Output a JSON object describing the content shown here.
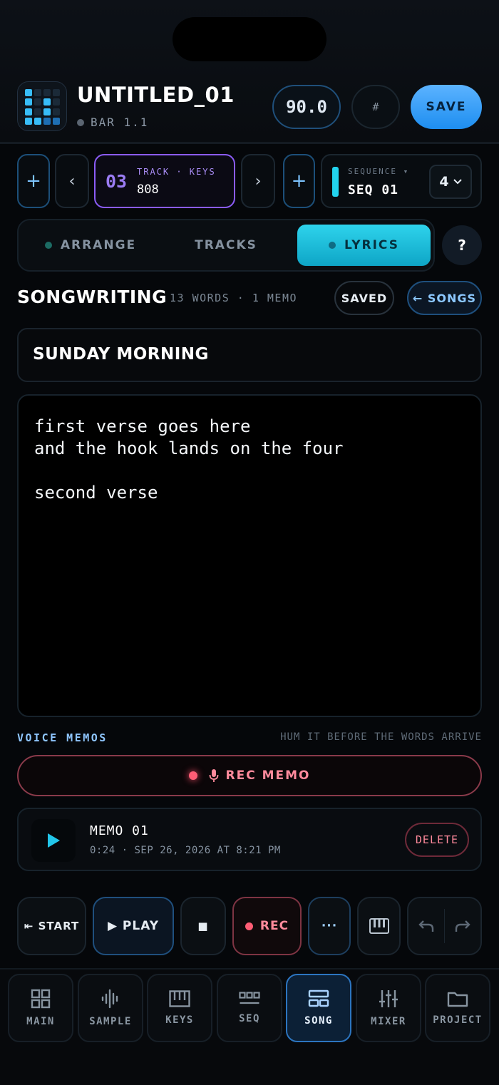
{
  "header": {
    "project_title": "UNTITLED_01",
    "bar_position": "BAR 1.1",
    "bpm": "90.0",
    "hash_label": "#",
    "save_label": "SAVE"
  },
  "track": {
    "add_label": "+",
    "prev_label": "‹",
    "next_label": "›",
    "number": "03",
    "caption": "TRACK · KEYS",
    "name": "808",
    "add_right_label": "+"
  },
  "sequence": {
    "caption": "SEQUENCE ▾",
    "name": "SEQ 01",
    "count": "4"
  },
  "tabs": [
    {
      "label": "ARRANGE",
      "active": false
    },
    {
      "label": "TRACKS",
      "active": false
    },
    {
      "label": "LYRICS",
      "active": true
    }
  ],
  "help_label": "?",
  "songwriting": {
    "title": "SONGWRITING",
    "meta": "13 WORDS · 1 MEMO",
    "saved_label": "SAVED",
    "songs_label": "← SONGS",
    "song_title": "SUNDAY MORNING",
    "lyrics": "first verse goes here\nand the hook lands on the four\n\nsecond verse"
  },
  "voice_memos": {
    "label": "VOICE MEMOS",
    "hint": "HUM IT BEFORE THE WORDS ARRIVE",
    "rec_label": "REC MEMO",
    "memos": [
      {
        "name": "MEMO 01",
        "meta": "0:24 · SEP 26, 2026 AT 8:21 PM",
        "delete_label": "DELETE"
      }
    ]
  },
  "transport": {
    "start_label": "⇤ START",
    "play_label": "▶ PLAY",
    "stop_label": "■",
    "rec_label": "REC",
    "more_label": "···"
  },
  "nav": [
    {
      "label": "MAIN",
      "icon": "grid-icon",
      "active": false
    },
    {
      "label": "SAMPLE",
      "icon": "waveform-icon",
      "active": false
    },
    {
      "label": "KEYS",
      "icon": "piano-icon",
      "active": false
    },
    {
      "label": "SEQ",
      "icon": "sequencer-icon",
      "active": false
    },
    {
      "label": "SONG",
      "icon": "song-icon",
      "active": true
    },
    {
      "label": "MIXER",
      "icon": "sliders-icon",
      "active": false
    },
    {
      "label": "PROJECT",
      "icon": "folder-icon",
      "active": false
    }
  ],
  "colors": {
    "accent_cyan": "#22d3ee",
    "accent_blue": "#3b9cf5",
    "accent_purple": "#8b5cf6",
    "rec_red": "#ff5d75"
  }
}
